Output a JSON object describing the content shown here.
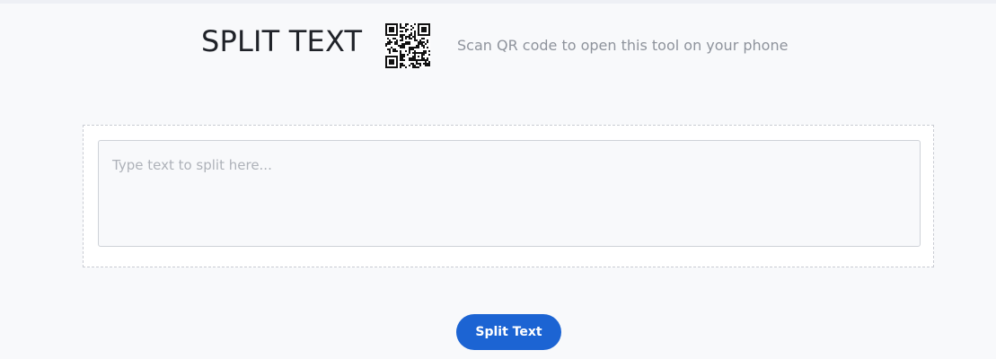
{
  "header": {
    "title": "SPLIT TEXT",
    "qr_caption": "Scan QR code to open this tool on your phone",
    "qr_icon": "qr-code-icon"
  },
  "tool": {
    "input_placeholder": "Type text to split here...",
    "input_value": "",
    "split_button_label": "Split Text"
  },
  "colors": {
    "accent": "#1c64d3",
    "background": "#f8f9fb",
    "title_text": "#1f2228",
    "caption_text": "#8e939c",
    "placeholder_text": "#aeb2b9"
  }
}
